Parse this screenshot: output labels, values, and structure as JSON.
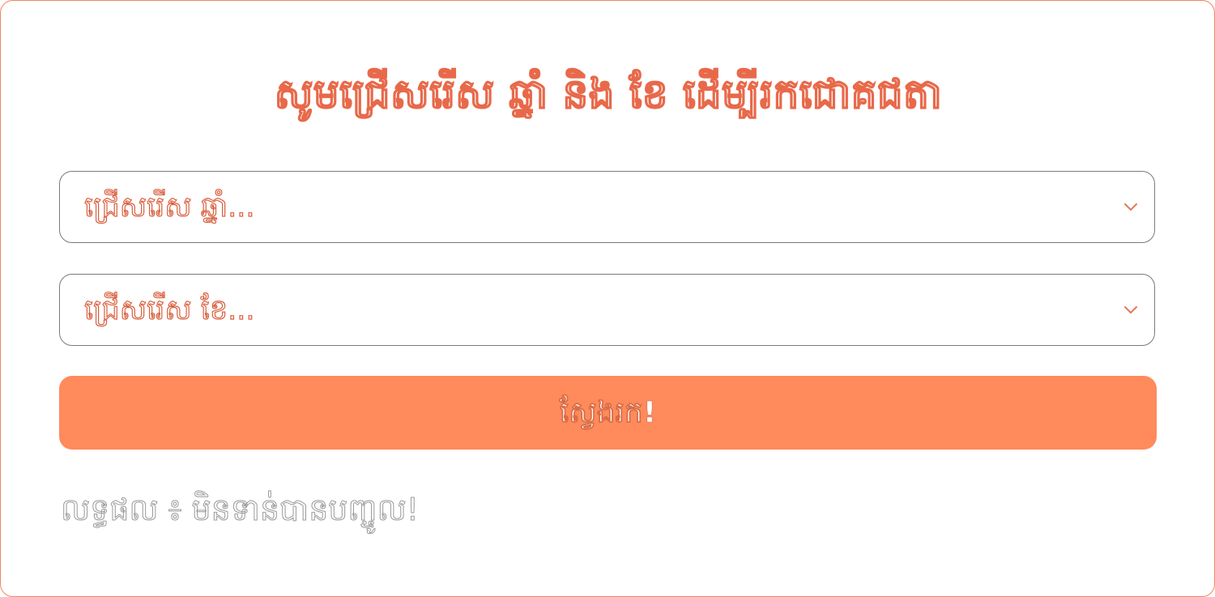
{
  "form": {
    "title": "សូមជ្រើសរើស ឆ្នាំ និង ខែ ដើម្បីរកជោគជតា",
    "year_select": {
      "placeholder": "ជ្រើសរើស ឆ្នាំ..."
    },
    "month_select": {
      "placeholder": "ជ្រើសរើស ខែ..."
    },
    "search_button": {
      "label": "ស្វែងរក!"
    },
    "result": {
      "text": "លទ្ធផល ៖ មិនទាន់បានបញ្ចូល!"
    }
  },
  "icons": {
    "dropdown": "chevron-down-icon"
  },
  "colors": {
    "accent": "#ff8a5c",
    "title": "#e8694a",
    "border": "#7a7a7a",
    "card_border": "#f0875f",
    "result_text": "#9a9a9a"
  }
}
